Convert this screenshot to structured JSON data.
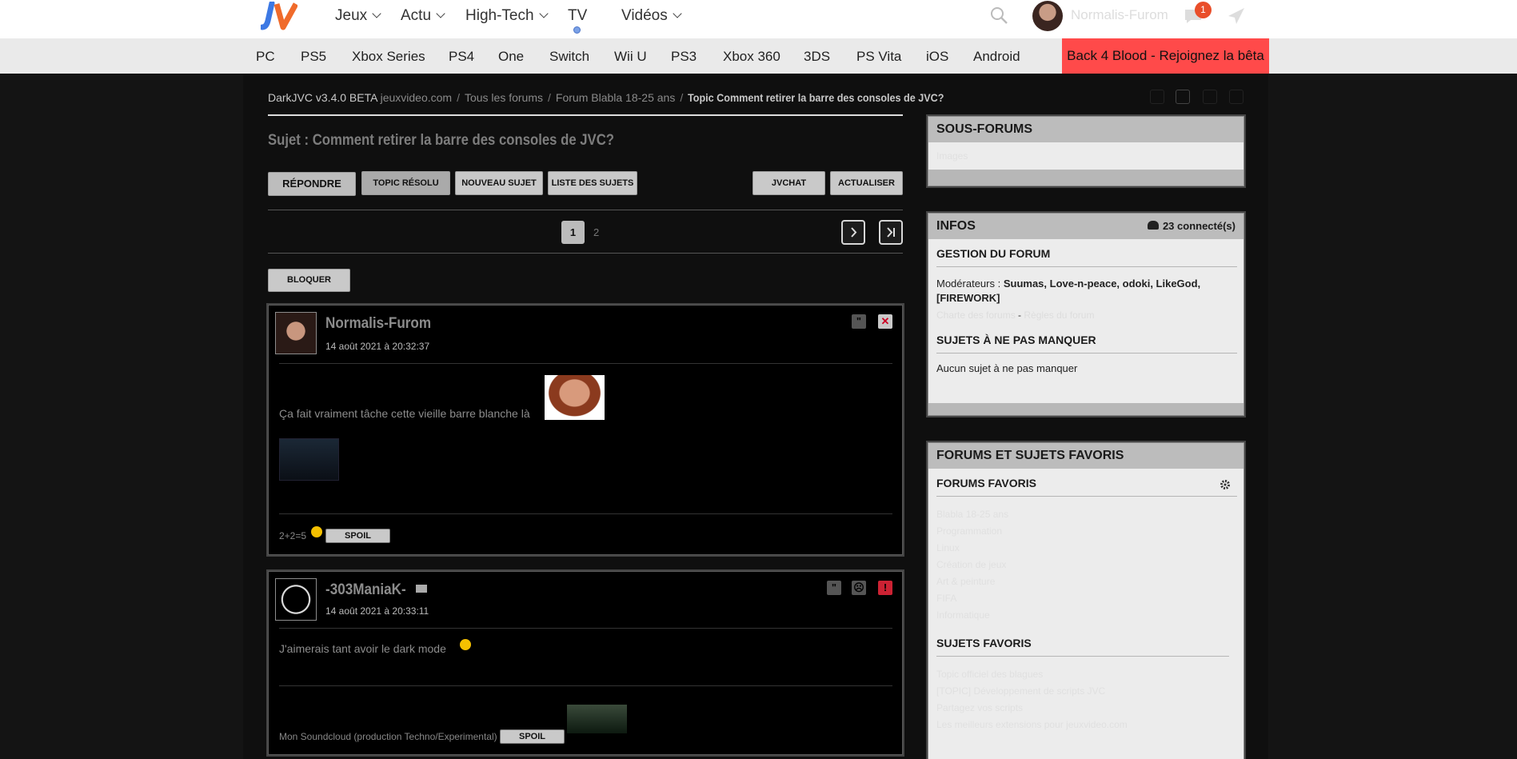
{
  "nav": {
    "items": [
      {
        "label": "Jeux",
        "dropdown": true
      },
      {
        "label": "Actu",
        "dropdown": true
      },
      {
        "label": "High-Tech",
        "dropdown": true
      },
      {
        "label": "TV",
        "dropdown": false
      },
      {
        "label": "Vidéos",
        "dropdown": true
      }
    ],
    "username": "Normalis-Furom",
    "notif_count": "1",
    "logo": "JV"
  },
  "consoles": [
    "PC",
    "PS5",
    "Xbox Series",
    "PS4",
    "One",
    "Switch",
    "Wii U",
    "PS3",
    "Xbox 360",
    "3DS",
    "PS Vita",
    "iOS",
    "Android"
  ],
  "promo": "Back 4 Blood - Rejoignez la bêta",
  "breadcrumb": {
    "app": "DarkJVC v3.4.0 BETA",
    "site": "jeuxvideo.com",
    "forums": "Tous les forums",
    "forum": "Forum Blabla 18-25 ans",
    "topic": "Topic Comment retirer la barre des consoles de JVC?"
  },
  "topic_title": "Sujet : Comment retirer la barre des consoles de JVC?",
  "buttons": {
    "reply": "Répondre",
    "resolved": "Topic résolu",
    "new_topic": "Nouveau sujet",
    "list": "Liste des sujets",
    "jvchat": "JVChat",
    "refresh": "Actualiser",
    "block": "Bloquer"
  },
  "pager": {
    "current": "1",
    "next": "2"
  },
  "posts": [
    {
      "author": "Normalis-Furom",
      "date": "14 août 2021 à 20:32:37",
      "text": "Ça fait vraiment tâche cette vieille barre blanche là",
      "signature": "2+2=5",
      "spoil": "SPOIL"
    },
    {
      "author": "-303ManiaK-",
      "date": "14 août 2021 à 20:33:11",
      "text": "J'aimerais tant avoir le dark mode",
      "signature": "Mon Soundcloud (production Techno/Experimental)",
      "spoil": "SPOIL"
    }
  ],
  "side": {
    "subforums": {
      "title": "SOUS-FORUMS",
      "item": "Images"
    },
    "infos": {
      "title": "INFOS",
      "connected": "23 connecté(s)",
      "gestion": "GESTION DU FORUM",
      "mods_label": "Modérateurs : ",
      "mods": "Suumas, Love-n-peace, odoki, LikeGod, [FIREWORK]",
      "charter": "Charte des forums",
      "sep": " - ",
      "rules": "Règles du forum",
      "must_title": "SUJETS À NE PAS MANQUER",
      "must_text": "Aucun sujet à ne pas manquer"
    },
    "favs": {
      "title": "FORUMS ET SUJETS FAVORIS",
      "forums_title": "FORUMS FAVORIS",
      "forums": [
        "Blabla 18-25 ans",
        "Programmation",
        "Linux",
        "Création de jeux",
        "Art & peinture",
        "FIFA",
        "Informatique"
      ],
      "subjects_title": "SUJETS FAVORIS",
      "subjects": [
        "Topic officiel des blagues",
        "[TOPIC] Développement de scripts JVC",
        "Partagez vos scripts",
        "Les meilleurs extensions pour jeuxvideo.com"
      ]
    }
  },
  "colors": {
    "promo": "#ff4a4a",
    "badge": "#e94e2a",
    "logo_blue": "#3d79e4",
    "logo_orange": "#f06b2b"
  }
}
